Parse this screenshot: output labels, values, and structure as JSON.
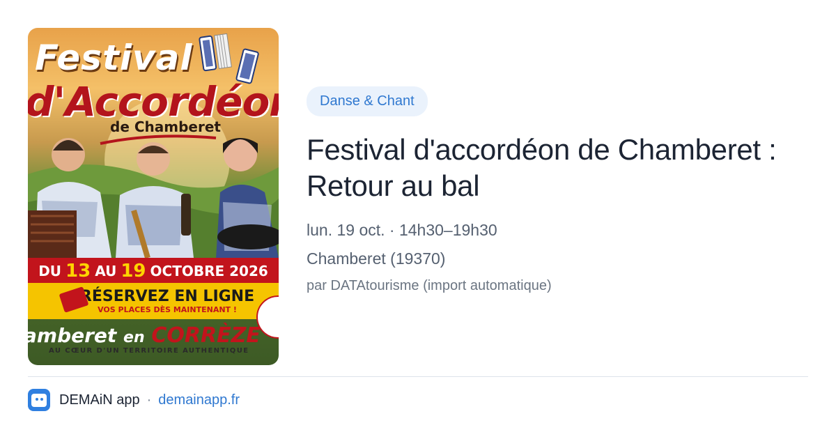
{
  "event": {
    "category": "Danse & Chant",
    "title": "Festival d'accordéon de Chamberet : Retour au bal",
    "datetime": "lun. 19 oct. · 14h30–19h30",
    "location": "Chamberet (19370)",
    "source": "par DATAtourisme (import automatique)"
  },
  "poster": {
    "line1": "Festival",
    "line2": "d'Accordéon",
    "line3": "de Chamberet",
    "dates_prefix": "DU",
    "dates_day1": "13",
    "dates_mid": "AU",
    "dates_day2": "19",
    "dates_suffix": "OCTOBRE 2026",
    "booking": "RÉSERVEZ EN LIGNE",
    "booking_sub": "VOS PLACES DÈS MAINTENANT !",
    "footer_town": "amberet",
    "footer_en": "en",
    "footer_region": "CORRÈZE",
    "footer_tagline": "AU CŒUR D'UN TERRITOIRE AUTHENTIQUE"
  },
  "footer": {
    "app_name": "DEMAiN app",
    "separator": "·",
    "domain": "demainapp.fr"
  },
  "colors": {
    "accent": "#2f78d0",
    "tag_bg": "#eaf2fc",
    "poster_red": "#c2141c",
    "poster_yellow": "#f5c400"
  }
}
